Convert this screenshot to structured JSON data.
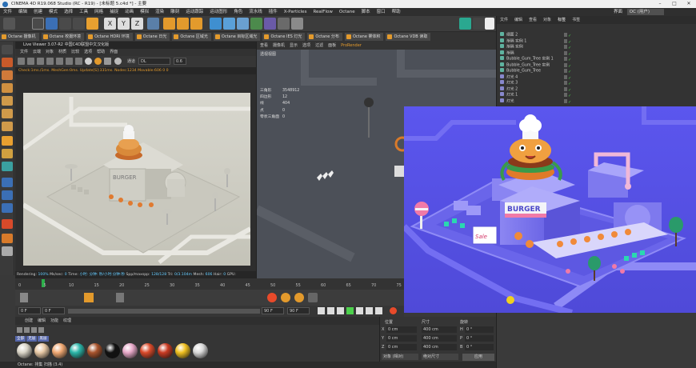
{
  "window": {
    "title": "CINEMA 4D R19.068 Studio (RC - R19) - [未标题 5.c4d *] - 主要",
    "interface_label": "界面",
    "interface_value": "OC (用户)",
    "minimize": "–",
    "maximize": "□",
    "close": "✕"
  },
  "menubar": [
    "文件",
    "编辑",
    "创建",
    "模式",
    "选择",
    "工具",
    "网格",
    "捕捉",
    "动画",
    "模拟",
    "渲染",
    "雕刻",
    "运动跟踪",
    "运动图形",
    "角色",
    "流水线",
    "插件",
    "X-Particles",
    "RealFlow",
    "Octane",
    "脚本",
    "窗口",
    "帮助"
  ],
  "toolbar": {
    "axis_x": "X",
    "axis_y": "Y",
    "axis_z": "Z"
  },
  "octane_strip": [
    "Octane 摄像机",
    "Octane 校摄环境",
    "Octane HDRI 环境",
    "Octane 日光",
    "Octane 区域光",
    "Octane 目标区域光",
    "Octane IES 灯光",
    "Octane 分布",
    "Octane 雾体积",
    "Octane VDB 读取"
  ],
  "live_viewer": {
    "title": "Live Viewer 3.07-R2 中国C4D联盟中文汉化版",
    "menu": [
      "文件",
      "云端",
      "对象",
      "材质",
      "比较",
      "选项",
      "帮助",
      "界面"
    ],
    "mode_label": "通道",
    "mode_value": "DL",
    "mode_num": "0.6",
    "status_line": "Check:1ms./1ms. MeshGen:0ms. Update[S]:331ms. Nodes:1234 Movable:606  0 0",
    "bottom": {
      "rendering_label": "Rendering:",
      "rendering_value": "100%",
      "ms_label": "Ms/sec:",
      "ms_value": "0",
      "time_label": "Time:",
      "time_value": "小时: 分钟: 秒/小时:分钟:秒",
      "spp_label": "Spp/maxspp:",
      "spp_value": "128/128",
      "tri_label": "Tri:",
      "tri_value": "0/3.104m",
      "mesh_label": "Mesh:",
      "mesh_value": "606",
      "hair_label": "Hair:",
      "hair_value": "0",
      "gpu_label": "GPU:"
    }
  },
  "viewport": {
    "menu": [
      "查看",
      "摄像机",
      "显示",
      "选项",
      "过滤",
      "面板",
      "ProRender"
    ],
    "title": "透视视图",
    "stats": [
      {
        "label": "三角形",
        "value": "3548912"
      },
      {
        "label": "四边形",
        "value": "12"
      },
      {
        "label": "线",
        "value": "404"
      },
      {
        "label": "点",
        "value": "0"
      },
      {
        "label": "零状三角面",
        "value": "0"
      }
    ]
  },
  "overlay_scene": {
    "sign_text": "BURGER",
    "sale_text": "Sale"
  },
  "object_manager": {
    "tabs": [
      "文件",
      "编辑",
      "查看",
      "对象",
      "标签",
      "书签"
    ],
    "active_tab": "标签",
    "rows": [
      {
        "name": "细面 2",
        "color": "#5fb3a0"
      },
      {
        "name": "渐隔 实例 1",
        "color": "#5fb3a0"
      },
      {
        "name": "渐隔 实例",
        "color": "#5fb3a0"
      },
      {
        "name": "渐隔",
        "color": "#5fb3a0"
      },
      {
        "name": "Bubble_Gum_Tree 实例 1",
        "color": "#5fb3a0"
      },
      {
        "name": "Bubble_Gum_Tree 实例",
        "color": "#5fb3a0"
      },
      {
        "name": "Bubble_Gum_Tree",
        "color": "#5fb3a0"
      },
      {
        "name": "灯光 4",
        "color": "#8888cc"
      },
      {
        "name": "灯光 3",
        "color": "#8888cc"
      },
      {
        "name": "灯光 2",
        "color": "#8888cc"
      },
      {
        "name": "灯光 1",
        "color": "#8888cc"
      },
      {
        "name": "灯光",
        "color": "#8888cc"
      }
    ]
  },
  "timeline": {
    "ticks": [
      "0",
      "5",
      "10",
      "15",
      "20",
      "25",
      "30",
      "35",
      "40",
      "45",
      "50",
      "55",
      "60",
      "65",
      "70",
      "75"
    ],
    "start_frame": "0 F",
    "current_frame": "0 F",
    "end_frame": "90 F",
    "end_frame2": "90 F"
  },
  "materials": {
    "tabs": [
      "创建",
      "编辑",
      "功能",
      "纹理"
    ],
    "filters": [
      "全部",
      "无层",
      "黑层"
    ],
    "balls": [
      "#d9d4c7",
      "#e8c9a6",
      "#f0a872",
      "#2bb5a8",
      "#a8532c",
      "#111111",
      "#e6a8c8",
      "#d94a2a",
      "#c83a22",
      "#f0c020",
      "#d8d8d8"
    ]
  },
  "coordinates": {
    "headers": [
      "位置",
      "尺寸",
      "旋转"
    ],
    "rows": [
      {
        "axis": "X",
        "pos": "0 cm",
        "size": "400 cm",
        "rot_axis": "H",
        "rot": "0 °"
      },
      {
        "axis": "Y",
        "pos": "0 cm",
        "size": "400 cm",
        "rot_axis": "P",
        "rot": "0 °"
      },
      {
        "axis": "Z",
        "pos": "0 cm",
        "size": "400 cm",
        "rot_axis": "B",
        "rot": "0 °"
      }
    ],
    "mode1": "对象 (相对)",
    "mode2": "绝对尺寸",
    "apply": "应用"
  },
  "statusbar": "Octane: 排集 扫描 (3.4)"
}
